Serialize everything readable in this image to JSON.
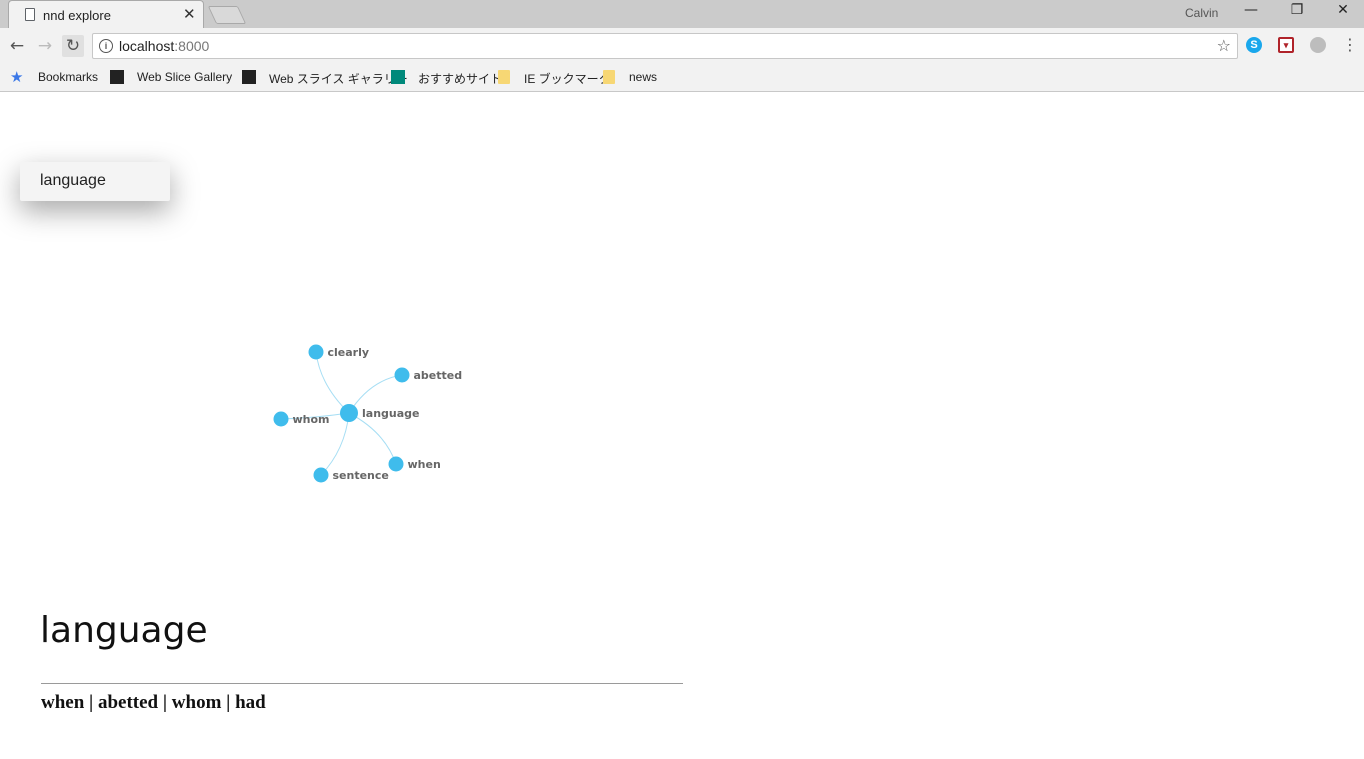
{
  "browser": {
    "tab_title": "nnd explore",
    "user_name": "Calvin",
    "url_host": "localhost",
    "url_port": ":8000",
    "bookmarks": [
      {
        "label": "Bookmarks"
      },
      {
        "label": "Web Slice Gallery"
      },
      {
        "label": "Web スライス ギャラリー"
      },
      {
        "label": "おすすめサイト"
      },
      {
        "label": "IE ブックマーク"
      },
      {
        "label": "news"
      }
    ]
  },
  "page": {
    "search_value": "language",
    "graph": {
      "center": "language",
      "neighbors": [
        "clearly",
        "abetted",
        "whom",
        "when",
        "sentence"
      ]
    },
    "headline": "language",
    "related_words": "when | abetted | whom | had"
  },
  "colors": {
    "node": "#3fbcec",
    "edge": "#a6def4"
  }
}
